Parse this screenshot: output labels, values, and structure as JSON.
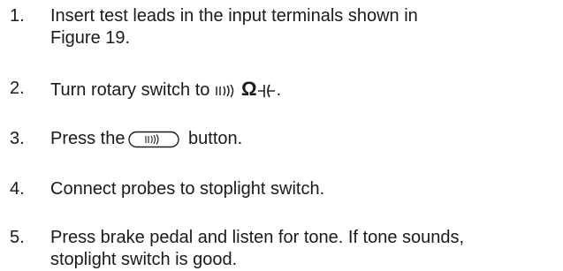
{
  "steps": [
    {
      "number": "1.",
      "lines": [
        "Insert test leads in the input terminals shown in",
        "Figure 19."
      ]
    },
    {
      "number": "2.",
      "text_before": "Turn rotary switch to ",
      "omega": "Ω",
      "text_after": ".",
      "symbols": [
        "continuity-beeper-icon",
        "capacitor-icon"
      ]
    },
    {
      "number": "3.",
      "text_before": "Press the",
      "text_after": " button.",
      "symbols": [
        "continuity-button-icon"
      ]
    },
    {
      "number": "4.",
      "lines": [
        "Connect probes to stoplight switch."
      ]
    },
    {
      "number": "5.",
      "lines": [
        "Press brake pedal and listen for tone. If tone sounds,",
        "stoplight switch is good."
      ]
    }
  ]
}
